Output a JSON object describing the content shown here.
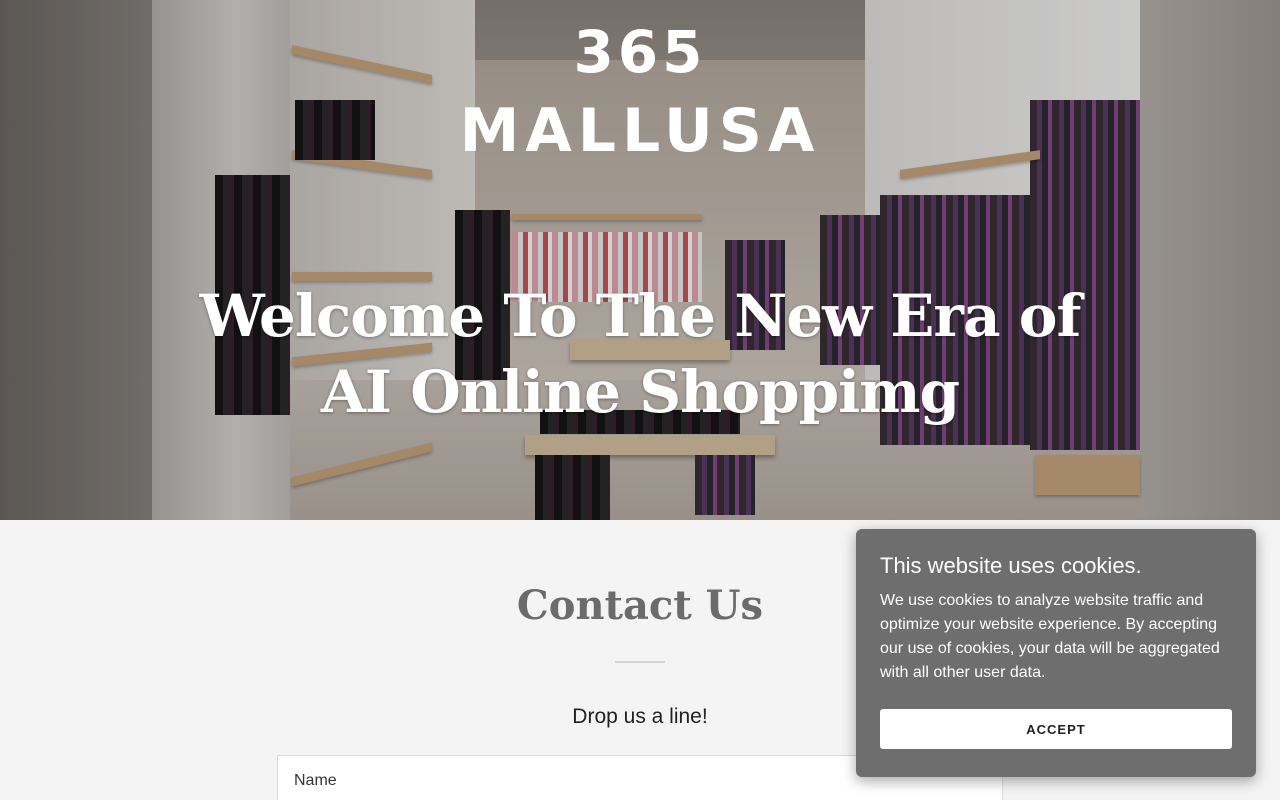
{
  "brand": {
    "line1": "365",
    "line2": "MALLUSA"
  },
  "hero": {
    "title_line1": "Welcome To The New Era of",
    "title_line2": "AI Online Shoppimg"
  },
  "contact": {
    "title": "Contact Us",
    "subtitle": "Drop us a line!",
    "form": {
      "name_label": "Name"
    }
  },
  "cookie_banner": {
    "title": "This website uses cookies.",
    "text": "We use cookies to analyze website traffic and optimize your website experience. By accepting our use of cookies, your data will be aggregated with all other user data.",
    "accept_label": "ACCEPT"
  },
  "colors": {
    "page_background": "#f4f4f4",
    "cookie_background": "#6e6e6e",
    "heading_gray": "#6b6b6b"
  }
}
